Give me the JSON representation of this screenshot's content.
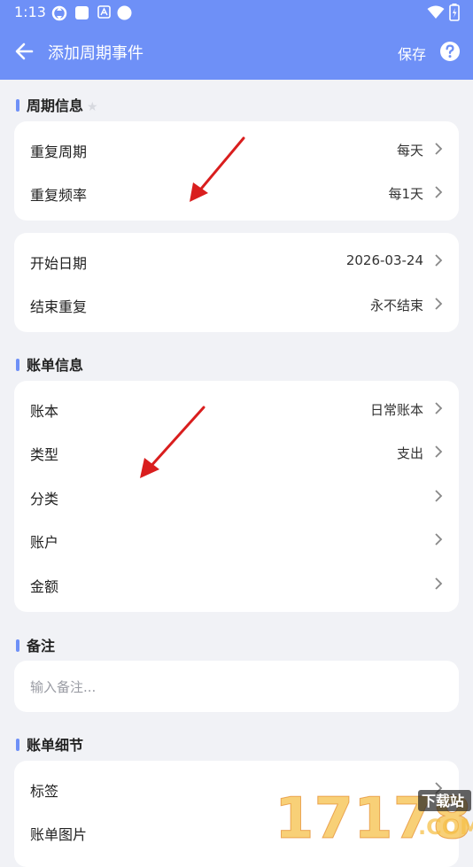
{
  "status_bar": {
    "time": "1:13"
  },
  "header": {
    "title": "添加周期事件",
    "save_label": "保存"
  },
  "sections": {
    "cycle_info": "周期信息",
    "bill_info": "账单信息",
    "note": "备注",
    "bill_detail": "账单细节"
  },
  "cycle_card": {
    "repeat_cycle": {
      "label": "重复周期",
      "value": "每天"
    },
    "repeat_freq": {
      "label": "重复频率",
      "value": "每1天"
    }
  },
  "date_card": {
    "start_date": {
      "label": "开始日期",
      "value": "2026-03-24"
    },
    "end_repeat": {
      "label": "结束重复",
      "value": "永不结束"
    }
  },
  "bill_card": {
    "book": {
      "label": "账本",
      "value": "日常账本"
    },
    "type": {
      "label": "类型",
      "value": "支出"
    },
    "category": {
      "label": "分类"
    },
    "account": {
      "label": "账户"
    },
    "amount": {
      "label": "金额"
    }
  },
  "note_card": {
    "placeholder": "输入备注..."
  },
  "detail_card": {
    "tags": {
      "label": "标签"
    },
    "images": {
      "label": "账单图片"
    }
  },
  "colors": {
    "accent": "#6e90f7",
    "background": "#f1f2f6",
    "annotation_arrow": "#d91e1e"
  }
}
